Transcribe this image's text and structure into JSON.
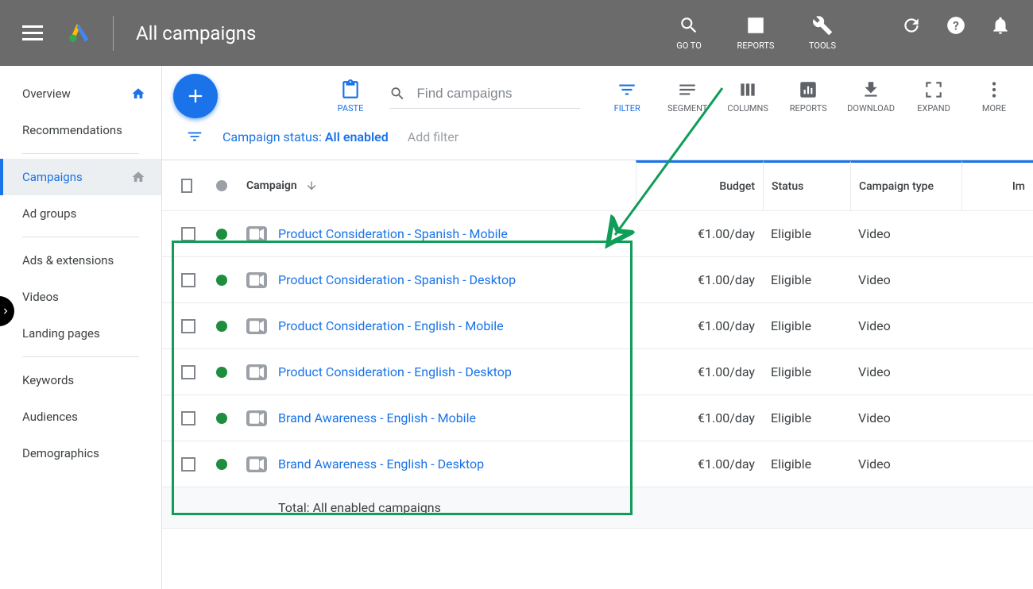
{
  "header": {
    "title": "All campaigns",
    "actions": [
      {
        "label": "GO TO",
        "icon": "search"
      },
      {
        "label": "REPORTS",
        "icon": "bar"
      },
      {
        "label": "TOOLS",
        "icon": "wrench"
      }
    ]
  },
  "sidebar": {
    "items": [
      {
        "label": "Overview",
        "home": true
      },
      {
        "label": "Recommendations"
      },
      {
        "label": "Campaigns",
        "active": true,
        "home": true
      },
      {
        "label": "Ad groups"
      },
      {
        "label": "Ads & extensions"
      },
      {
        "label": "Videos"
      },
      {
        "label": "Landing pages"
      },
      {
        "label": "Keywords"
      },
      {
        "label": "Audiences"
      },
      {
        "label": "Demographics"
      }
    ]
  },
  "toolbar": {
    "paste": "PASTE",
    "search_placeholder": "Find campaigns",
    "filter": "FILTER",
    "segment": "SEGMENT",
    "columns": "COLUMNS",
    "reports": "REPORTS",
    "download": "DOWNLOAD",
    "expand": "EXPAND",
    "more": "MORE"
  },
  "filterbar": {
    "status_label": "Campaign status: ",
    "status_value": "All enabled",
    "add_filter": "Add filter"
  },
  "columns": {
    "campaign": "Campaign",
    "budget": "Budget",
    "status": "Status",
    "type": "Campaign type",
    "impr": "Im"
  },
  "rows": [
    {
      "name": "Product Consideration - Spanish - Mobile",
      "budget": "€1.00/day",
      "status": "Eligible",
      "type": "Video"
    },
    {
      "name": "Product Consideration - Spanish - Desktop",
      "budget": "€1.00/day",
      "status": "Eligible",
      "type": "Video"
    },
    {
      "name": "Product Consideration - English - Mobile",
      "budget": "€1.00/day",
      "status": "Eligible",
      "type": "Video"
    },
    {
      "name": "Product Consideration - English - Desktop",
      "budget": "€1.00/day",
      "status": "Eligible",
      "type": "Video"
    },
    {
      "name": "Brand Awareness - English - Mobile",
      "budget": "€1.00/day",
      "status": "Eligible",
      "type": "Video"
    },
    {
      "name": "Brand Awareness - English - Desktop",
      "budget": "€1.00/day",
      "status": "Eligible",
      "type": "Video"
    }
  ],
  "total_row": "Total: All enabled campaigns"
}
